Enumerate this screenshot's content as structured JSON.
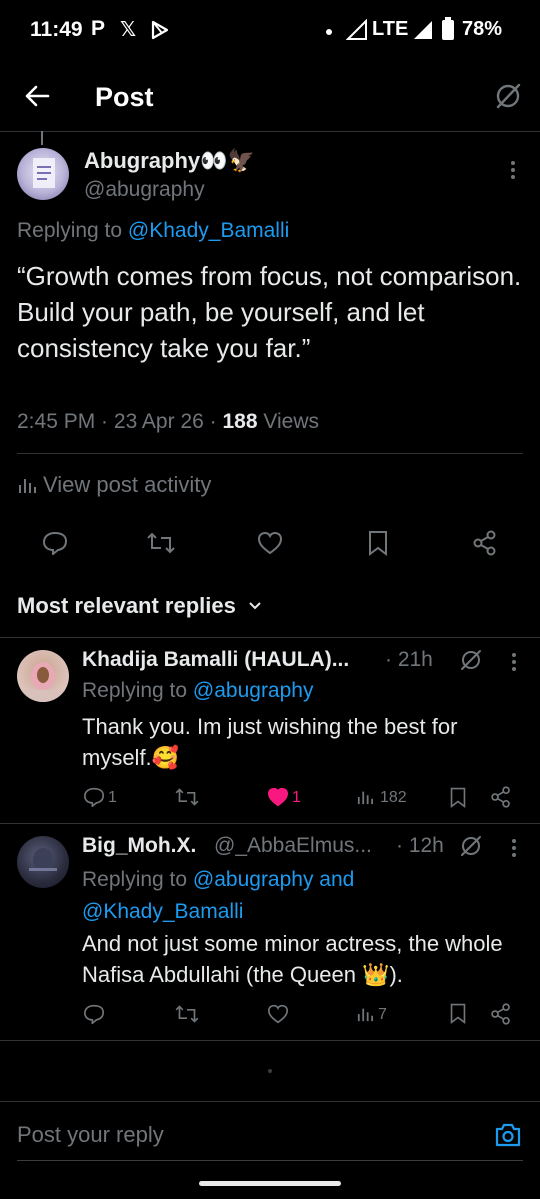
{
  "status_bar": {
    "time": "11:49",
    "network": "LTE",
    "battery": "78%"
  },
  "header": {
    "title": "Post"
  },
  "post": {
    "author_name": "Abugraphy",
    "author_emoji": "👀🦅",
    "handle": "@abugraphy",
    "replying_prefix": "Replying to",
    "replying_to": "@Khady_Bamalli",
    "text": "“Growth comes from focus, not comparison. Build your path, be yourself, and let consistency take you far.”",
    "time": "2:45 PM",
    "date": "23 Apr 26",
    "views_count": "188",
    "views_label": "Views",
    "activity_label": "View post activity"
  },
  "replies_header": {
    "label": "Most relevant replies"
  },
  "replies": [
    {
      "name": "Khadija Bamalli (HAULA)...",
      "age": "· 21h",
      "replying_prefix": "Replying to",
      "replying_to": "@abugraphy",
      "text": "Thank you. Im just wishing the best for myself.🥰",
      "reply_count": "1",
      "like_count": "1",
      "views": "182"
    },
    {
      "name": "Big_Moh.X.",
      "handle": "@_AbbaElmus...",
      "age": "· 12h",
      "replying_prefix": "Replying to",
      "replying_to": "@abugraphy and @Khady_Bamalli",
      "text": "And not just some minor actress, the whole Nafisa Abdullahi (the Queen 👑).",
      "views": "7"
    }
  ],
  "composer": {
    "placeholder": "Post your reply"
  },
  "colors": {
    "accent": "#1d9bf0",
    "like": "#f91880",
    "muted": "#71767b",
    "background": "#000000"
  }
}
